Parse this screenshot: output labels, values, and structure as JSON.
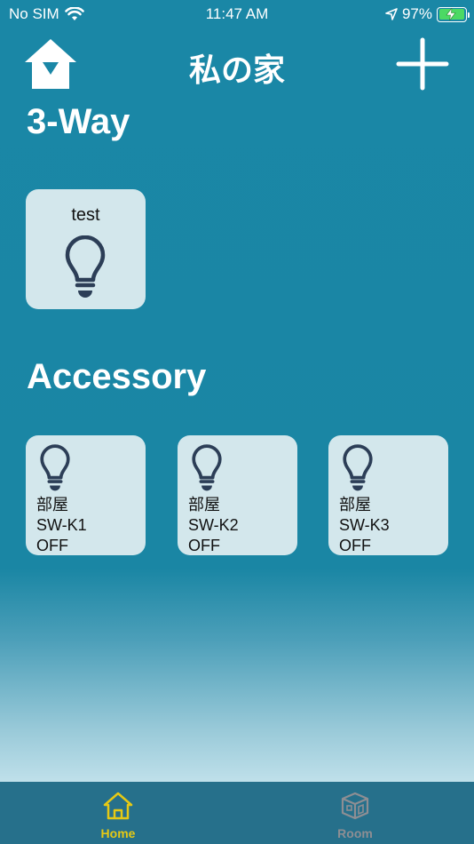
{
  "status_bar": {
    "carrier": "No SIM",
    "time": "11:47 AM",
    "battery_percent": "97%",
    "battery_level": 0.97
  },
  "nav": {
    "title": "私の家",
    "home_icon": "house-arrow-icon",
    "add_icon": "plus-icon"
  },
  "sections": {
    "three_way": {
      "title": "3-Way",
      "tiles": [
        {
          "name": "test",
          "icon": "lightbulb-icon"
        }
      ]
    },
    "accessory": {
      "title": "Accessory",
      "tiles": [
        {
          "room": "部屋",
          "name": "SW-K1",
          "state": "OFF",
          "icon": "lightbulb-icon"
        },
        {
          "room": "部屋",
          "name": "SW-K2",
          "state": "OFF",
          "icon": "lightbulb-icon"
        },
        {
          "room": "部屋",
          "name": "SW-K3",
          "state": "OFF",
          "icon": "lightbulb-icon"
        }
      ]
    }
  },
  "tab_bar": {
    "tabs": [
      {
        "label": "Home",
        "icon": "home-icon",
        "active": true,
        "color": "#e6c914"
      },
      {
        "label": "Room",
        "icon": "room-cube-icon",
        "active": false,
        "color": "#8e8e93"
      }
    ]
  }
}
